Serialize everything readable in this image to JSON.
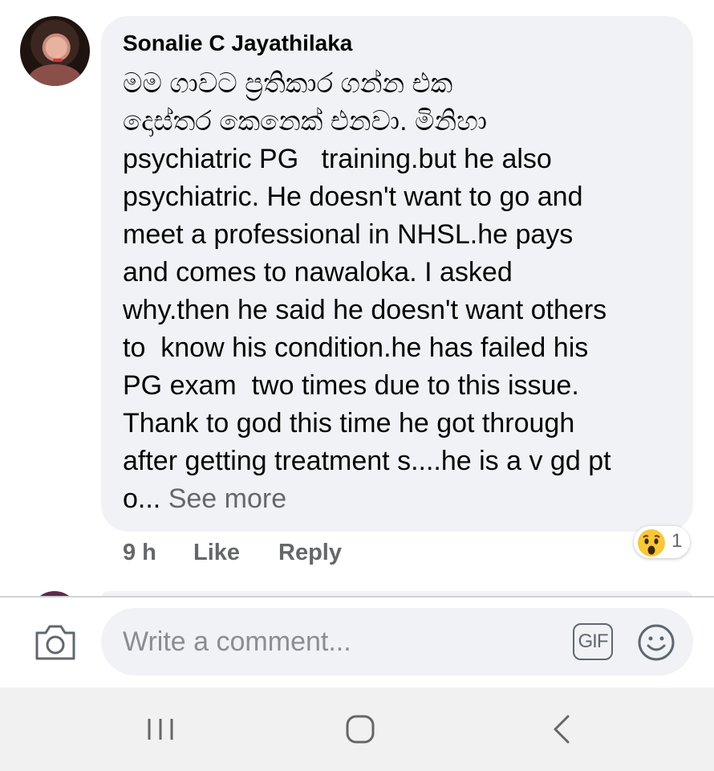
{
  "comment": {
    "author": "Sonalie C Jayathilaka",
    "lines": [
      "මම ගාවට ප්‍රතිකාර ගන්න එක",
      "දොස්තර කෙනෙක් එනවා. මිනිහා",
      "psychiatric PG   training.but he also",
      "psychiatric. He doesn't want to go and",
      "meet a professional in NHSL.he pays",
      "and comes to nawaloka. I asked",
      "why.then he said he doesn't want others",
      "to  know his condition.he has failed his",
      "PG exam  two times due to this issue.",
      "Thank to god this time he got through",
      "after getting treatment s....he is a v gd pt"
    ],
    "last_line_prefix": "o... ",
    "see_more": "See more",
    "time": "9 h",
    "like": "Like",
    "reply": "Reply",
    "reaction": {
      "icon": "wow-emoji-icon",
      "count": "1"
    }
  },
  "composer": {
    "placeholder": "Write a comment...",
    "camera_icon": "camera-icon",
    "gif_label": "GIF",
    "emoji_icon": "smiley-icon"
  },
  "navbar": {
    "icons": [
      "recent-apps-icon",
      "home-icon",
      "back-icon"
    ]
  },
  "colors": {
    "bubble": "#f0f2f5",
    "text": "#050505",
    "secondary": "#65676b",
    "navbar": "#f1f1f1"
  }
}
